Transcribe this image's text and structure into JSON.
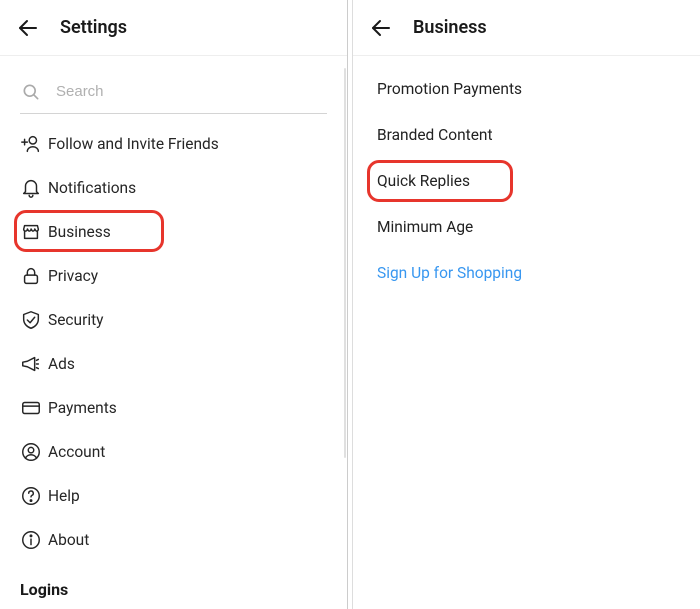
{
  "left": {
    "title": "Settings",
    "search_placeholder": "Search",
    "items": [
      {
        "label": "Follow and Invite Friends"
      },
      {
        "label": "Notifications"
      },
      {
        "label": "Business"
      },
      {
        "label": "Privacy"
      },
      {
        "label": "Security"
      },
      {
        "label": "Ads"
      },
      {
        "label": "Payments"
      },
      {
        "label": "Account"
      },
      {
        "label": "Help"
      },
      {
        "label": "About"
      }
    ],
    "section_logins": "Logins"
  },
  "right": {
    "title": "Business",
    "items": [
      {
        "label": "Promotion Payments"
      },
      {
        "label": "Branded Content"
      },
      {
        "label": "Quick Replies"
      },
      {
        "label": "Minimum Age"
      },
      {
        "label": "Sign Up for Shopping"
      }
    ]
  }
}
